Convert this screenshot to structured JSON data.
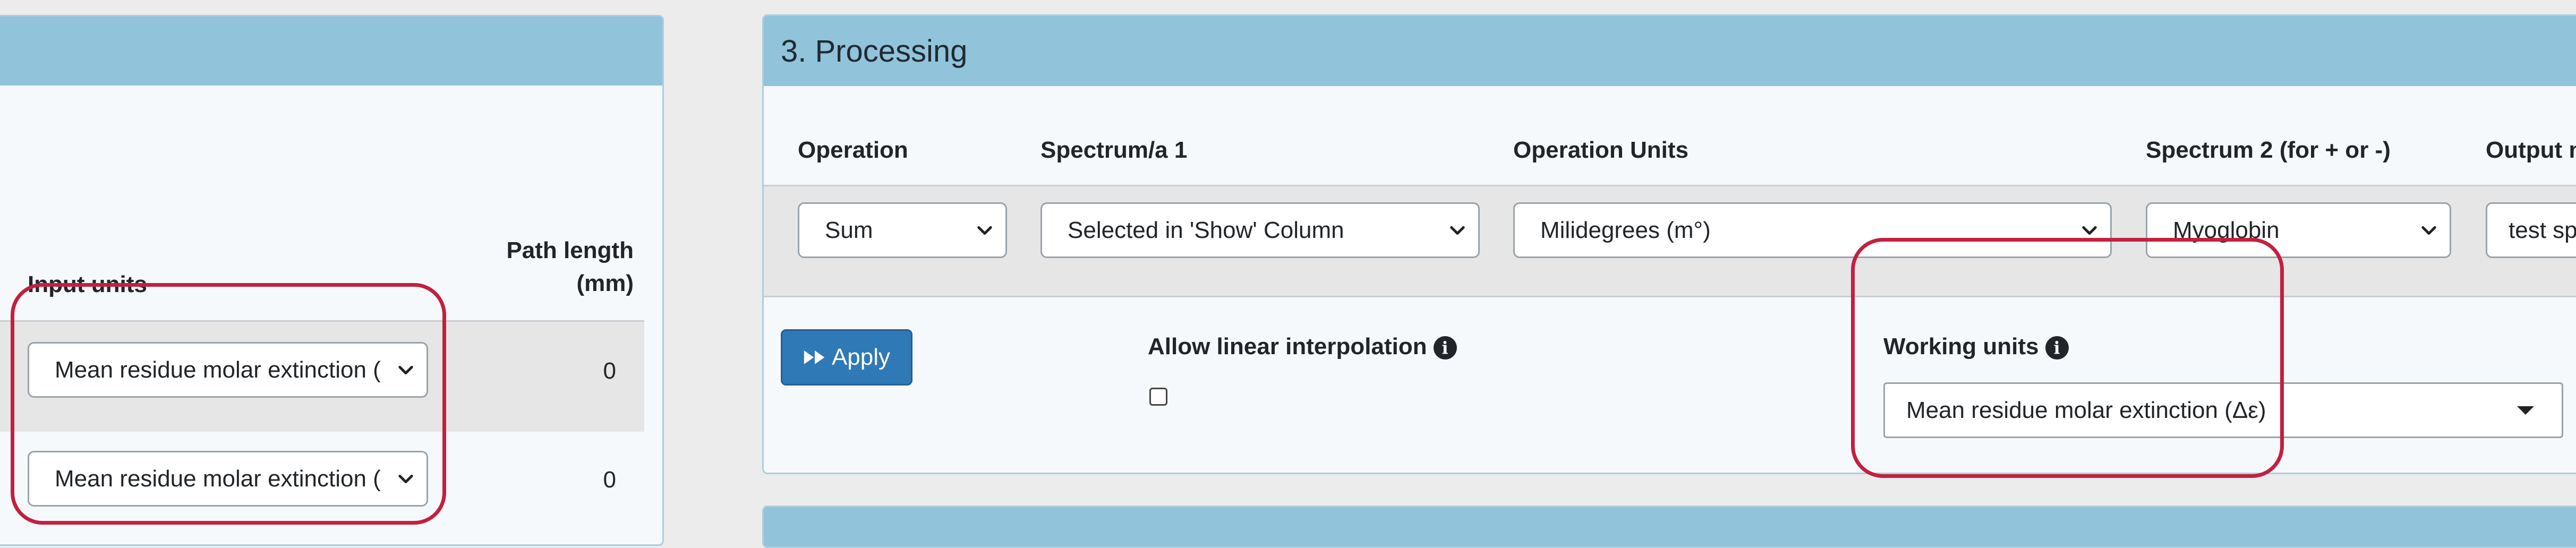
{
  "input_panel": {
    "col_input_units": "Input units",
    "col_path_length_line1": "Path length",
    "col_path_length_line2": "(mm)",
    "rows": [
      {
        "units": "Mean residue molar extinction (",
        "path_length": "0"
      },
      {
        "units": "Mean residue molar extinction (",
        "path_length": "0"
      }
    ]
  },
  "processing_panel": {
    "title": "3. Processing",
    "columns": {
      "operation": "Operation",
      "spectrum1": "Spectrum/a 1",
      "operation_units": "Operation Units",
      "spectrum2": "Spectrum 2 (for + or -)",
      "output": "Output n"
    },
    "values": {
      "operation": "Sum",
      "spectrum1": "Selected in 'Show' Column",
      "operation_units": "Milidegrees (m°)",
      "spectrum2": "Myoglobin",
      "output": "test spe"
    },
    "apply_button": "Apply",
    "allow_linear_interpolation": "Allow linear interpolation",
    "allow_linear_interpolation_checked": false,
    "working_units_label": "Working units",
    "working_units_value": "Mean residue molar extinction (Δε)"
  },
  "colors": {
    "header_blue": "#91c3da",
    "button_blue": "#2f79b7",
    "highlight_red": "#c2203f"
  }
}
